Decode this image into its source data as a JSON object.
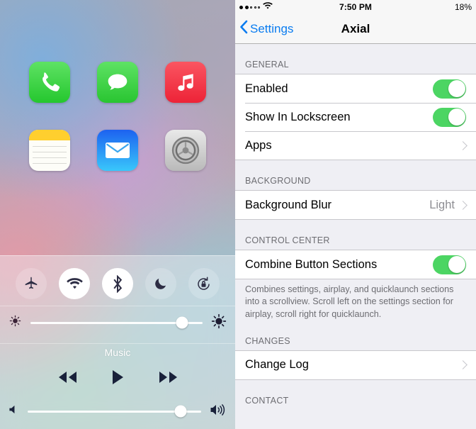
{
  "home_screen": {
    "apps": [
      {
        "name": "Phone",
        "icon": "phone-icon"
      },
      {
        "name": "Messages",
        "icon": "messages-icon"
      },
      {
        "name": "Music",
        "icon": "music-icon"
      },
      {
        "name": "Notes",
        "icon": "notes-icon"
      },
      {
        "name": "Mail",
        "icon": "mail-icon"
      },
      {
        "name": "Settings",
        "icon": "settings-gear-icon"
      }
    ]
  },
  "control_center": {
    "toggles": [
      {
        "name": "airplane-mode",
        "icon": "airplane-icon",
        "active": false
      },
      {
        "name": "wifi",
        "icon": "wifi-icon",
        "active": true
      },
      {
        "name": "bluetooth",
        "icon": "bluetooth-icon",
        "active": true
      },
      {
        "name": "do-not-disturb",
        "icon": "moon-icon",
        "active": false
      },
      {
        "name": "rotation-lock",
        "icon": "rotation-lock-icon",
        "active": false
      }
    ],
    "brightness": {
      "label": "Brightness",
      "value": 88,
      "low_icon": "brightness-low-icon",
      "high_icon": "brightness-high-icon"
    },
    "music": {
      "title": "Music",
      "previous_label": "Previous",
      "play_label": "Play",
      "next_label": "Next"
    },
    "volume": {
      "label": "Volume",
      "value": 88,
      "low_icon": "volume-low-icon",
      "high_icon": "volume-high-icon"
    }
  },
  "settings": {
    "status_bar": {
      "signal_dots_filled": 2,
      "signal_dots_total": 5,
      "carrier_icon": "wifi-icon",
      "time": "7:50 PM",
      "battery": "18%"
    },
    "nav": {
      "back_label": "Settings",
      "back_icon": "chevron-left-icon",
      "title": "Axial"
    },
    "sections": [
      {
        "header": "GENERAL",
        "rows": [
          {
            "label": "Enabled",
            "type": "switch",
            "on": true
          },
          {
            "label": "Show In Lockscreen",
            "type": "switch",
            "on": true
          },
          {
            "label": "Apps",
            "type": "disclosure"
          }
        ]
      },
      {
        "header": "BACKGROUND",
        "rows": [
          {
            "label": "Background Blur",
            "type": "disclosure",
            "value": "Light"
          }
        ]
      },
      {
        "header": "CONTROL CENTER",
        "rows": [
          {
            "label": "Combine Button Sections",
            "type": "switch",
            "on": true
          }
        ],
        "footnote": "Combines settings, airplay, and quicklaunch sections into a scrollview. Scroll left on the settings section for airplay, scroll right for quicklaunch."
      },
      {
        "header": "CHANGES",
        "rows": [
          {
            "label": "Change Log",
            "type": "disclosure"
          }
        ]
      },
      {
        "header": "CONTACT",
        "rows": []
      }
    ]
  },
  "colors": {
    "switch_on": "#4cd563",
    "tint_blue": "#0a7cf0",
    "group_bg": "#efeff4",
    "separator": "#c8c7cc",
    "secondary_text": "#6d6d72"
  }
}
